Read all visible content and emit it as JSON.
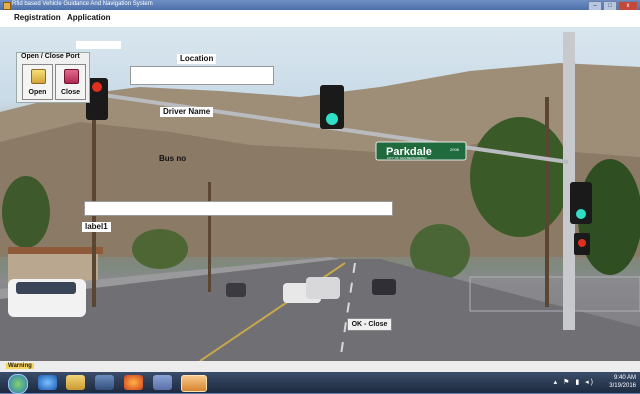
{
  "window": {
    "title": "Rfid based Vehicle Guidance And Navigation System",
    "controls": [
      "–",
      "□",
      "x"
    ]
  },
  "menu": [
    "Registration",
    "Application"
  ],
  "port_group": {
    "caption": "Open / Close Port",
    "open_label": "Open",
    "close_label": "Close"
  },
  "labels": {
    "location": "Location",
    "driver_name": "Driver Name",
    "bus_no": "Bus no",
    "label1": "label1"
  },
  "fields": {
    "location_value": "",
    "driver_value": "",
    "top_value": ""
  },
  "scene": {
    "street_sign": "Parkdale",
    "street_sign_suffix": "2008",
    "street_sign_small": "CITY OF SAN BERNARDINO"
  },
  "ok_button": "OK - Close",
  "status": {
    "warning": "Warning"
  },
  "tray": {
    "time": "9:40 AM",
    "date": "3/19/2016"
  }
}
